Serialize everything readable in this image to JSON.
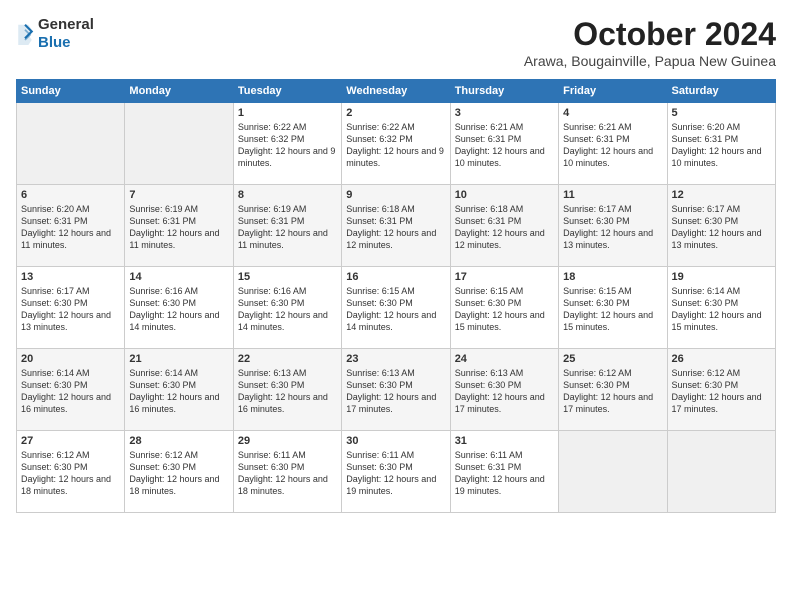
{
  "logo": {
    "general": "General",
    "blue": "Blue"
  },
  "title": "October 2024",
  "subtitle": "Arawa, Bougainville, Papua New Guinea",
  "days_header": [
    "Sunday",
    "Monday",
    "Tuesday",
    "Wednesday",
    "Thursday",
    "Friday",
    "Saturday"
  ],
  "weeks": [
    [
      {
        "day": "",
        "empty": true
      },
      {
        "day": "",
        "empty": true
      },
      {
        "day": "1",
        "sunrise": "6:22 AM",
        "sunset": "6:32 PM",
        "daylight": "12 hours and 9 minutes."
      },
      {
        "day": "2",
        "sunrise": "6:22 AM",
        "sunset": "6:32 PM",
        "daylight": "12 hours and 9 minutes."
      },
      {
        "day": "3",
        "sunrise": "6:21 AM",
        "sunset": "6:31 PM",
        "daylight": "12 hours and 10 minutes."
      },
      {
        "day": "4",
        "sunrise": "6:21 AM",
        "sunset": "6:31 PM",
        "daylight": "12 hours and 10 minutes."
      },
      {
        "day": "5",
        "sunrise": "6:20 AM",
        "sunset": "6:31 PM",
        "daylight": "12 hours and 10 minutes."
      }
    ],
    [
      {
        "day": "6",
        "sunrise": "6:20 AM",
        "sunset": "6:31 PM",
        "daylight": "12 hours and 11 minutes."
      },
      {
        "day": "7",
        "sunrise": "6:19 AM",
        "sunset": "6:31 PM",
        "daylight": "12 hours and 11 minutes."
      },
      {
        "day": "8",
        "sunrise": "6:19 AM",
        "sunset": "6:31 PM",
        "daylight": "12 hours and 11 minutes."
      },
      {
        "day": "9",
        "sunrise": "6:18 AM",
        "sunset": "6:31 PM",
        "daylight": "12 hours and 12 minutes."
      },
      {
        "day": "10",
        "sunrise": "6:18 AM",
        "sunset": "6:31 PM",
        "daylight": "12 hours and 12 minutes."
      },
      {
        "day": "11",
        "sunrise": "6:17 AM",
        "sunset": "6:30 PM",
        "daylight": "12 hours and 13 minutes."
      },
      {
        "day": "12",
        "sunrise": "6:17 AM",
        "sunset": "6:30 PM",
        "daylight": "12 hours and 13 minutes."
      }
    ],
    [
      {
        "day": "13",
        "sunrise": "6:17 AM",
        "sunset": "6:30 PM",
        "daylight": "12 hours and 13 minutes."
      },
      {
        "day": "14",
        "sunrise": "6:16 AM",
        "sunset": "6:30 PM",
        "daylight": "12 hours and 14 minutes."
      },
      {
        "day": "15",
        "sunrise": "6:16 AM",
        "sunset": "6:30 PM",
        "daylight": "12 hours and 14 minutes."
      },
      {
        "day": "16",
        "sunrise": "6:15 AM",
        "sunset": "6:30 PM",
        "daylight": "12 hours and 14 minutes."
      },
      {
        "day": "17",
        "sunrise": "6:15 AM",
        "sunset": "6:30 PM",
        "daylight": "12 hours and 15 minutes."
      },
      {
        "day": "18",
        "sunrise": "6:15 AM",
        "sunset": "6:30 PM",
        "daylight": "12 hours and 15 minutes."
      },
      {
        "day": "19",
        "sunrise": "6:14 AM",
        "sunset": "6:30 PM",
        "daylight": "12 hours and 15 minutes."
      }
    ],
    [
      {
        "day": "20",
        "sunrise": "6:14 AM",
        "sunset": "6:30 PM",
        "daylight": "12 hours and 16 minutes."
      },
      {
        "day": "21",
        "sunrise": "6:14 AM",
        "sunset": "6:30 PM",
        "daylight": "12 hours and 16 minutes."
      },
      {
        "day": "22",
        "sunrise": "6:13 AM",
        "sunset": "6:30 PM",
        "daylight": "12 hours and 16 minutes."
      },
      {
        "day": "23",
        "sunrise": "6:13 AM",
        "sunset": "6:30 PM",
        "daylight": "12 hours and 17 minutes."
      },
      {
        "day": "24",
        "sunrise": "6:13 AM",
        "sunset": "6:30 PM",
        "daylight": "12 hours and 17 minutes."
      },
      {
        "day": "25",
        "sunrise": "6:12 AM",
        "sunset": "6:30 PM",
        "daylight": "12 hours and 17 minutes."
      },
      {
        "day": "26",
        "sunrise": "6:12 AM",
        "sunset": "6:30 PM",
        "daylight": "12 hours and 17 minutes."
      }
    ],
    [
      {
        "day": "27",
        "sunrise": "6:12 AM",
        "sunset": "6:30 PM",
        "daylight": "12 hours and 18 minutes."
      },
      {
        "day": "28",
        "sunrise": "6:12 AM",
        "sunset": "6:30 PM",
        "daylight": "12 hours and 18 minutes."
      },
      {
        "day": "29",
        "sunrise": "6:11 AM",
        "sunset": "6:30 PM",
        "daylight": "12 hours and 18 minutes."
      },
      {
        "day": "30",
        "sunrise": "6:11 AM",
        "sunset": "6:30 PM",
        "daylight": "12 hours and 19 minutes."
      },
      {
        "day": "31",
        "sunrise": "6:11 AM",
        "sunset": "6:31 PM",
        "daylight": "12 hours and 19 minutes."
      },
      {
        "day": "",
        "empty": true
      },
      {
        "day": "",
        "empty": true
      }
    ]
  ]
}
